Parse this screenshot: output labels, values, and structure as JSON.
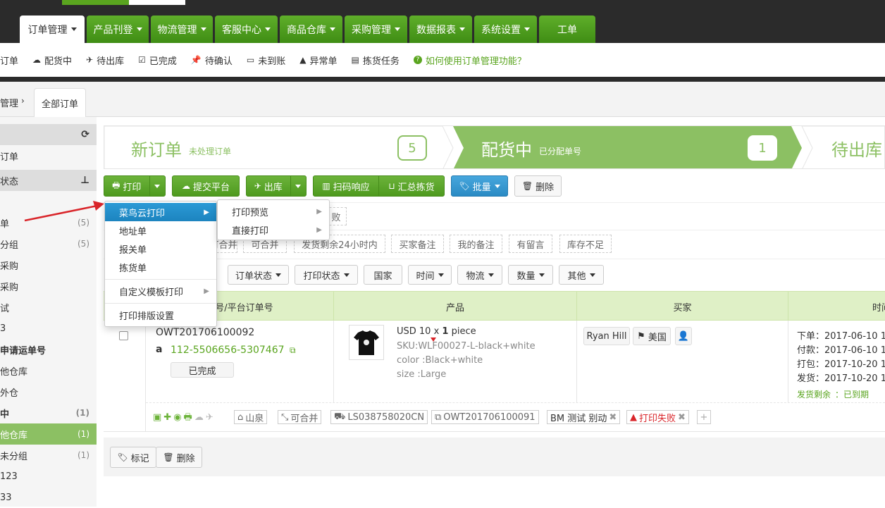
{
  "topnav": {
    "tabs": [
      {
        "label": "订单管理",
        "caret": true
      },
      {
        "label": "产品刊登",
        "caret": true
      },
      {
        "label": "物流管理",
        "caret": true
      },
      {
        "label": "客服中心",
        "caret": true
      },
      {
        "label": "商品仓库",
        "caret": true
      },
      {
        "label": "采购管理",
        "caret": true
      },
      {
        "label": "数据报表",
        "caret": true
      },
      {
        "label": "系统设置",
        "caret": true
      },
      {
        "label": "工单",
        "caret": false
      }
    ]
  },
  "subnav": {
    "items": [
      {
        "icon": "list-icon",
        "label": "订单"
      },
      {
        "icon": "cloud-icon",
        "label": "配货中"
      },
      {
        "icon": "plane-icon",
        "label": "待出库"
      },
      {
        "icon": "check-square-icon",
        "label": "已完成"
      },
      {
        "icon": "pin-icon",
        "label": "待确认"
      },
      {
        "icon": "card-icon",
        "label": "未到账"
      },
      {
        "icon": "warning-icon",
        "label": "异常单"
      },
      {
        "icon": "barcode-icon",
        "label": "拣货任务"
      }
    ],
    "help": "如何使用订单管理功能？"
  },
  "breadcrumb": {
    "parent": "管理",
    "current": "全部订单"
  },
  "sidebar": {
    "rows": [
      {
        "label": "",
        "count": "",
        "type": "head",
        "icon": "refresh-icon"
      },
      {
        "label": "订单",
        "count": "",
        "type": "normal"
      },
      {
        "label": "状态",
        "count": "",
        "type": "head",
        "icon": "sitemap-icon"
      },
      {
        "label": "",
        "count": "",
        "type": "normal"
      },
      {
        "label": "单",
        "count": "(5)",
        "type": "normal"
      },
      {
        "label": "分组",
        "count": "(5)",
        "type": "normal"
      },
      {
        "label": "采购",
        "count": "",
        "type": "normal"
      },
      {
        "label": "采购",
        "count": "",
        "type": "normal"
      },
      {
        "label": "试",
        "count": "",
        "type": "normal"
      },
      {
        "label": "3",
        "count": "",
        "type": "normal"
      },
      {
        "label": "申请运单号",
        "count": "",
        "type": "bold"
      },
      {
        "label": "他仓库",
        "count": "",
        "type": "normal"
      },
      {
        "label": "外仓",
        "count": "",
        "type": "normal"
      },
      {
        "label": "中",
        "count": "(1)",
        "type": "bold"
      },
      {
        "label": "他仓库",
        "count": "(1)",
        "type": "active"
      },
      {
        "label": "未分组",
        "count": "(1)",
        "type": "normal"
      },
      {
        "label": "123",
        "count": "",
        "type": "normal"
      },
      {
        "label": "33",
        "count": "",
        "type": "normal"
      }
    ]
  },
  "banner": {
    "stage1": {
      "title": "新订单",
      "sub": "未处理订单",
      "count": "5"
    },
    "stage2": {
      "title": "配货中",
      "sub": "已分配单号",
      "count": "1"
    },
    "stage3": {
      "title": "待出库"
    }
  },
  "toolbar": {
    "print": "打印",
    "submit_platform": "提交平台",
    "outbound": "出库",
    "scan": "扫码响应",
    "summary_pick": "汇总拣货",
    "batch": "批量",
    "delete": "删除"
  },
  "print_menu": {
    "items": [
      "菜鸟云打印",
      "地址单",
      "报关单",
      "拣货单",
      "自定义模板打印",
      "打印排版设置"
    ],
    "submenu": [
      "打印预览",
      "直接打印"
    ]
  },
  "filters": {
    "row1_partial": "败",
    "row2": [
      "可合并",
      "可合并",
      "发货剩余24小时内",
      "买家备注",
      "我的备注",
      "有留言",
      "库存不足"
    ],
    "row3": [
      "订单状态",
      "打印状态",
      "国家",
      "时间",
      "物流",
      "数量",
      "其他"
    ]
  },
  "table": {
    "headers": [
      "单号/平台订单号",
      "产品",
      "买家",
      "时间"
    ],
    "order": {
      "order_no": "OWT201706100092",
      "platform_no": "112-5506656-5307467",
      "status": "已完成",
      "product_price": "USD 10 x",
      "product_qty": "1",
      "product_unit": "piece",
      "sku": "SKU:WLF00027-L-black+white",
      "color": "color :Black+white",
      "size": "size :Large",
      "buyer": "Ryan Hill",
      "country": "美国",
      "times": [
        {
          "label": "下单：",
          "value": "2017-06-10 1"
        },
        {
          "label": "付款：",
          "value": "2017-06-10 1"
        },
        {
          "label": "打包：",
          "value": "2017-10-20 1"
        },
        {
          "label": "发货：",
          "value": "2017-10-20 1"
        }
      ],
      "ship_remaining_label": "发货剩余",
      "ship_remaining_value": "：已到期",
      "tags": {
        "warehouse": "山泉",
        "mergeable": "可合并",
        "tracking": "LS038758020CN",
        "ref_order": "OWT201706100091",
        "note": "BM 测试 别动",
        "print_fail": "打印失败"
      }
    }
  },
  "bottom": {
    "mark": "标记",
    "delete": "删除"
  },
  "colors": {
    "green": "#5aa51f",
    "active_green": "#8cc063",
    "blue": "#2b9ad6",
    "red": "#d9252a"
  }
}
